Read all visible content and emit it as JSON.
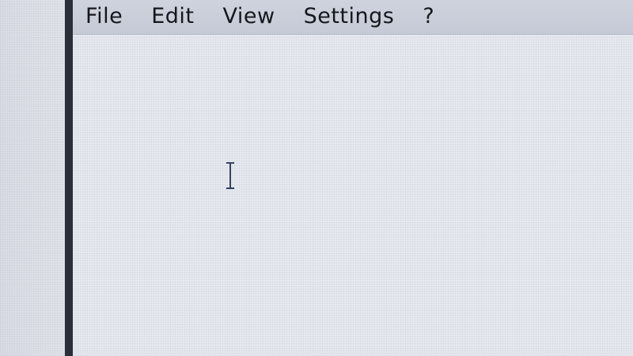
{
  "menubar": {
    "items": [
      {
        "label": "File"
      },
      {
        "label": "Edit"
      },
      {
        "label": "View"
      },
      {
        "label": "Settings"
      },
      {
        "label": "?"
      }
    ]
  },
  "cursor": {
    "icon": "text-cursor-icon"
  },
  "colors": {
    "menubar_bg": "#c9cdd9",
    "window_border": "#2a2f3a",
    "content_bg": "#e7e9f0"
  }
}
